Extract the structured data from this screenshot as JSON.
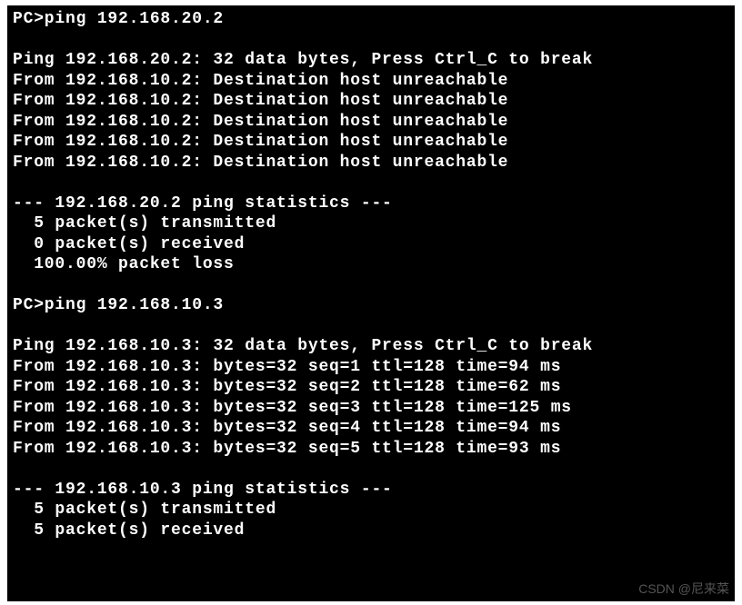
{
  "terminal": {
    "lines": [
      "PC>ping 192.168.20.2",
      "",
      "Ping 192.168.20.2: 32 data bytes, Press Ctrl_C to break",
      "From 192.168.10.2: Destination host unreachable",
      "From 192.168.10.2: Destination host unreachable",
      "From 192.168.10.2: Destination host unreachable",
      "From 192.168.10.2: Destination host unreachable",
      "From 192.168.10.2: Destination host unreachable",
      "",
      "--- 192.168.20.2 ping statistics ---",
      "  5 packet(s) transmitted",
      "  0 packet(s) received",
      "  100.00% packet loss",
      "",
      "PC>ping 192.168.10.3",
      "",
      "Ping 192.168.10.3: 32 data bytes, Press Ctrl_C to break",
      "From 192.168.10.3: bytes=32 seq=1 ttl=128 time=94 ms",
      "From 192.168.10.3: bytes=32 seq=2 ttl=128 time=62 ms",
      "From 192.168.10.3: bytes=32 seq=3 ttl=128 time=125 ms",
      "From 192.168.10.3: bytes=32 seq=4 ttl=128 time=94 ms",
      "From 192.168.10.3: bytes=32 seq=5 ttl=128 time=93 ms",
      "",
      "--- 192.168.10.3 ping statistics ---",
      "  5 packet(s) transmitted",
      "  5 packet(s) received"
    ]
  },
  "watermark": "CSDN @尼来菜"
}
